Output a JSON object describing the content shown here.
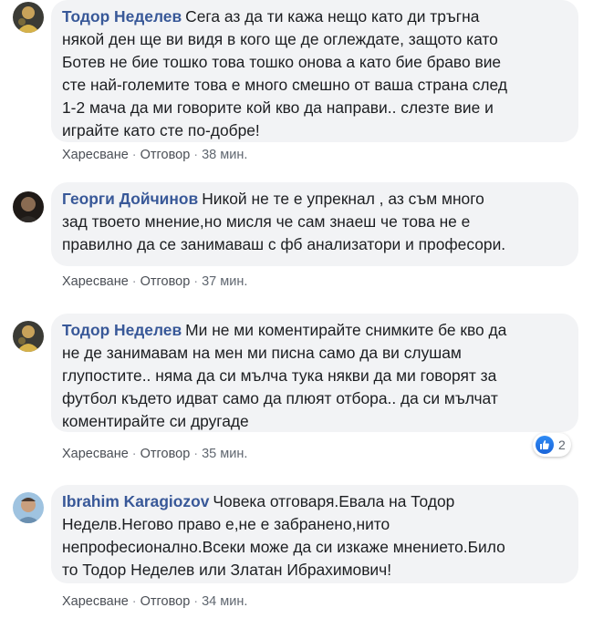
{
  "comments": [
    {
      "author": "Тодор Неделев",
      "lines": [
        "Сега аз да ти кажа нещо като ди тръгна",
        "някой ден ще ви видя в кого ще де оглеждате, защото като",
        "Ботев не бие тошко това тошко онова а като бие браво вие",
        "сте най-големите това е много смешно от ваша страна след",
        "1-2 мача да ми говорите кой кво да направи.. слезте вие и",
        "играйте като сте по-добре!"
      ],
      "like_label": "Харесване",
      "reply_label": "Отговор",
      "time": "38 мин."
    },
    {
      "author": "Георги Дойчинов",
      "lines": [
        "Никой не те е упрекнал , аз съм много",
        "зад твоето мнение,но мисля че сам знаеш че това не е",
        "правилно да се занимаваш с фб анализатори и професори."
      ],
      "like_label": "Харесване",
      "reply_label": "Отговор",
      "time": "37 мин."
    },
    {
      "author": "Тодор Неделев",
      "lines": [
        "Ми не ми коментирайте снимките бе кво да",
        "не де занимавам на мен ми писна само да ви слушам",
        "глупостите.. няма да си мълча тука някви да ми говорят за",
        "футбол където идват само да плюят отбора.. да си мълчат",
        "коментирайте си другаде"
      ],
      "like_label": "Харесване",
      "reply_label": "Отговор",
      "time": "35 мин.",
      "reaction_count": "2"
    },
    {
      "author": "Ibrahim Karagiozov",
      "lines": [
        "Човека отговаря.Евала на Тодор",
        "Неделв.Негово право е,не е забранено,нито",
        "непрофесионално.Всеки може да си изкаже мнението.Било",
        "то Тодор Неделев или Златан Ибрахимович!"
      ],
      "like_label": "Харесване",
      "reply_label": "Отговор",
      "time": "34 мин."
    }
  ],
  "colors": {
    "author": "#385898",
    "bubble": "#f2f3f5",
    "meta": "#606770",
    "like_blue": "#1a64d8"
  }
}
